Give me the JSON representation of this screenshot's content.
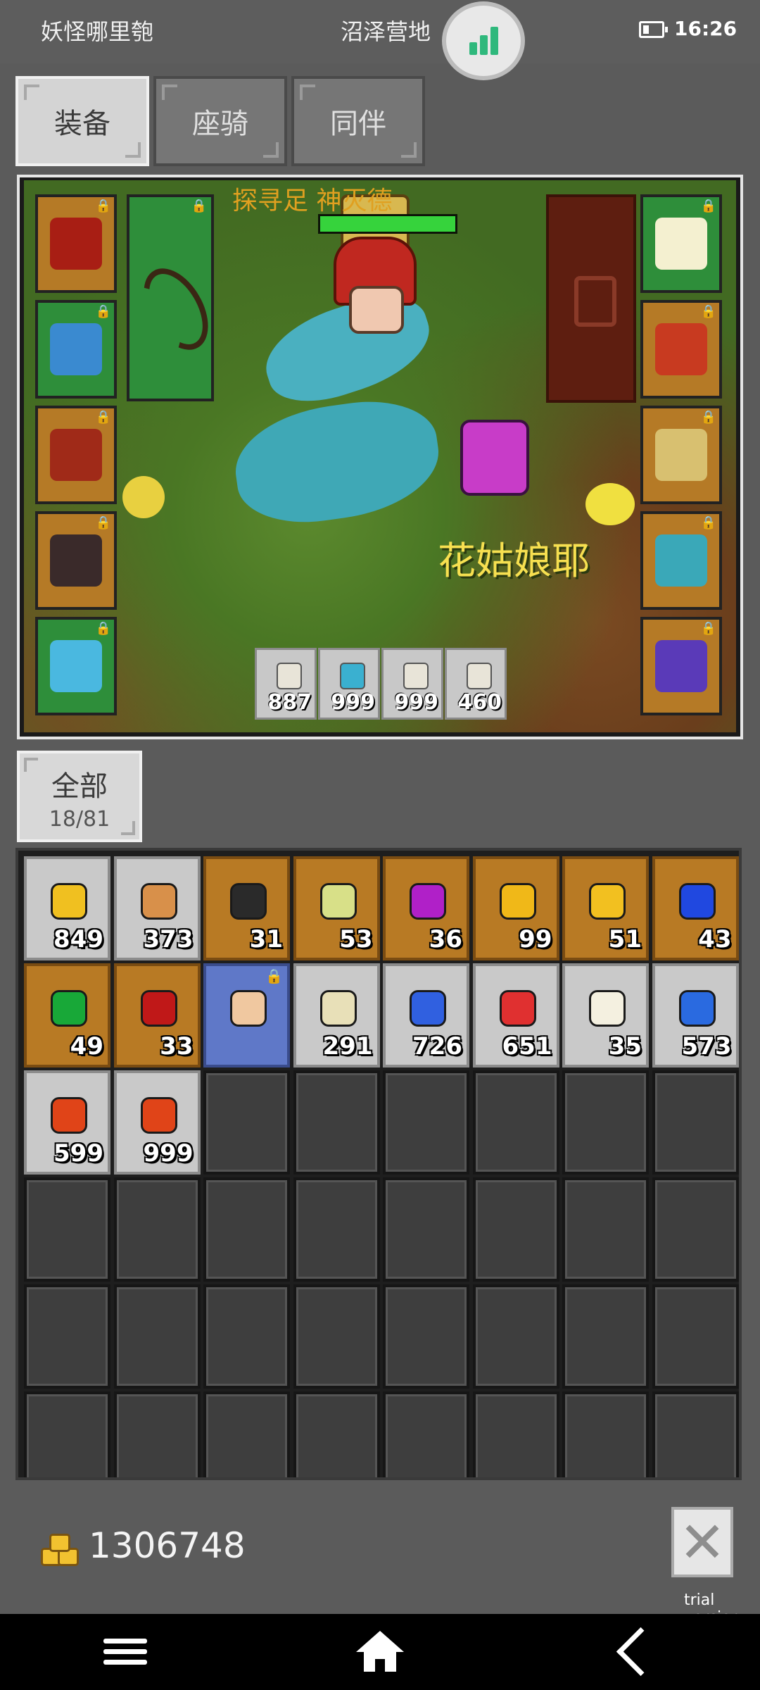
{
  "status_bar": {
    "left_text": "妖怪哪里匏",
    "location": "沼泽营地",
    "time": "16:26"
  },
  "tabs": [
    {
      "label": "装备",
      "active": true
    },
    {
      "label": "座骑",
      "active": false
    },
    {
      "label": "同伴",
      "active": false
    }
  ],
  "scene": {
    "title_strip": "探寻足   神灭德",
    "hp_fraction": 1.0,
    "npc_name": "花姑娘耶",
    "left_slots": [
      {
        "icon": "helmet-icon",
        "color": "brown"
      },
      {
        "icon": "armor-icon",
        "color": "green"
      },
      {
        "icon": "gloves-icon",
        "color": "brown"
      },
      {
        "icon": "boots-icon",
        "color": "brown"
      },
      {
        "icon": "belt-icon",
        "color": "green"
      }
    ],
    "right_slots": [
      {
        "icon": "antler-helm-icon",
        "color": "green"
      },
      {
        "icon": "amulet-icon",
        "color": "brown"
      },
      {
        "icon": "ring-icon",
        "color": "brown"
      },
      {
        "icon": "mount-head-icon",
        "color": "brown"
      },
      {
        "icon": "chest-icon",
        "color": "brown"
      }
    ],
    "quick_slots": [
      "887",
      "999",
      "999",
      "460"
    ]
  },
  "inventory": {
    "filter_label": "全部",
    "count": "18/81",
    "items": [
      {
        "icon": "gold-nugget-icon",
        "bg": "gray",
        "ic": "#f0c020",
        "count": "849"
      },
      {
        "icon": "bread-icon",
        "bg": "gray",
        "ic": "#d8904a",
        "count": "373"
      },
      {
        "icon": "black-gem-icon",
        "bg": "gold",
        "ic": "#2a2a2a",
        "count": "31"
      },
      {
        "icon": "pale-gem-icon",
        "bg": "gold",
        "ic": "#d8e088",
        "count": "53"
      },
      {
        "icon": "purple-gem-icon",
        "bg": "gold",
        "ic": "#b020c8",
        "count": "36"
      },
      {
        "icon": "yellow-gem-icon",
        "bg": "gold",
        "ic": "#f0b818",
        "count": "99"
      },
      {
        "icon": "yellow-gem-icon",
        "bg": "gold",
        "ic": "#f2c020",
        "count": "51"
      },
      {
        "icon": "blue-gem-icon",
        "bg": "gold",
        "ic": "#2048e0",
        "count": "43"
      },
      {
        "icon": "green-gem-icon",
        "bg": "gold",
        "ic": "#18a838",
        "count": "49"
      },
      {
        "icon": "red-gem-icon",
        "bg": "gold",
        "ic": "#c01818",
        "count": "33"
      },
      {
        "icon": "orb-icon",
        "bg": "blue",
        "ic": "#f0c8a0",
        "count": "",
        "locked": true
      },
      {
        "icon": "scroll-icon",
        "bg": "gray",
        "ic": "#e8e0b8",
        "count": "291"
      },
      {
        "icon": "blue-potion-icon",
        "bg": "gray",
        "ic": "#3060e0",
        "count": "726"
      },
      {
        "icon": "red-potion-icon",
        "bg": "gray",
        "ic": "#e03030",
        "count": "651"
      },
      {
        "icon": "feather-icon",
        "bg": "gray",
        "ic": "#f4f0e0",
        "count": "35"
      },
      {
        "icon": "blue-feather-icon",
        "bg": "gray",
        "ic": "#2a6ae0",
        "count": "573"
      },
      {
        "icon": "red-feather-icon",
        "bg": "gray",
        "ic": "#e04418",
        "count": "599"
      },
      {
        "icon": "red-feather-icon",
        "bg": "gray",
        "ic": "#e04418",
        "count": "999"
      }
    ],
    "total_slots": 48
  },
  "footer": {
    "gold": "1306748",
    "trial_label": "trial version"
  }
}
